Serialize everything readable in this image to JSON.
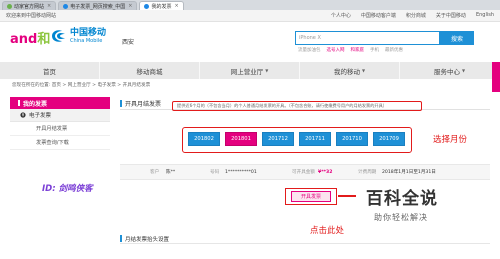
{
  "browser_tabs": [
    {
      "label": "动家官方网站",
      "icon": "globe-icon"
    },
    {
      "label": "电子发票_网页搜索_中国",
      "icon": "search-icon"
    },
    {
      "label": "我的发票",
      "icon": "page-icon",
      "active": true
    }
  ],
  "topbar": {
    "welcome": "欢迎来到中国移动网站",
    "links": [
      "个人中心",
      "中国移动客户端",
      "积分商城",
      "关于中国移动",
      "English"
    ]
  },
  "header": {
    "brand_and": "and",
    "brand_he": "和",
    "brand_cn": "中国移动",
    "brand_en": "China Mobile",
    "region": "西安",
    "search_placeholder": "iPhone X",
    "search_button": "搜索",
    "hotwords": [
      "流量加油包",
      "选号入网",
      "和家庭",
      "手机",
      "最新优惠"
    ]
  },
  "nav": {
    "items": [
      "首页",
      "移动商城",
      "网上营业厅",
      "我的移动",
      "服务中心"
    ]
  },
  "breadcrumb": "您现在所在的位置: 首页 > 网上营业厅 > 电子发票 > 开具月结发票",
  "sidebar": {
    "title": "我的发票",
    "group": "电子发票",
    "items": [
      "开具月结发票",
      "发票查询/下载"
    ]
  },
  "main": {
    "title": "开具月结发票",
    "notice": "提供近6个月的（不包含当月）的个人普通月结发票的开具。（不包含合账，请行使缴费号用户的月结发票的开具）",
    "months": [
      "201802",
      "201801",
      "201712",
      "201711",
      "201710",
      "201709"
    ],
    "selected_month": "201801",
    "annotation_select": "选择月份",
    "info": {
      "customer_label": "客户",
      "customer_value": "陈**",
      "number_label": "号码",
      "number_value": "1**********01",
      "amount_label": "可开具金额",
      "amount_value": "¥**32",
      "period_label": "计费周期",
      "period_value": "2018年1月1日至1月31日"
    },
    "invoice_button": "开具发票",
    "section2_title": "月结发票抬头设置",
    "annotation_click": "点击此处"
  },
  "watermark": {
    "id_text": "ID: 剑鸣侠客",
    "logo_big": "百科全说",
    "logo_small": "助你轻松解决"
  }
}
